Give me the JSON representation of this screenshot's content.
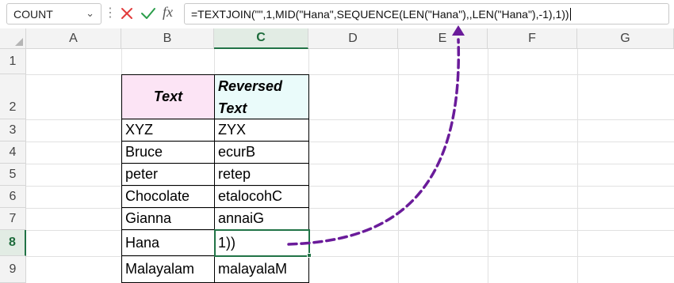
{
  "formula_bar": {
    "name_box": "COUNT",
    "formula": "=TEXTJOIN(\"\",1,MID(\"Hana\",SEQUENCE(LEN(\"Hana\"),,LEN(\"Hana\"),-1),1))",
    "icons": {
      "cancel": "x-icon",
      "enter": "check-icon",
      "function": "fx-icon",
      "more": "vertical-dots-icon"
    },
    "fx_label": "fx"
  },
  "columns": [
    "A",
    "B",
    "C",
    "D",
    "E",
    "F",
    "G"
  ],
  "rows": [
    "1",
    "2",
    "3",
    "4",
    "5",
    "6",
    "7",
    "8",
    "9"
  ],
  "active_cell": {
    "column": "C",
    "row": "8"
  },
  "table": {
    "header_text": "Text",
    "header_reversed_line1": "Reversed",
    "header_reversed_line2": "Text",
    "rows": [
      {
        "text": "XYZ",
        "reversed": "ZYX"
      },
      {
        "text": "Bruce",
        "reversed": "ecurB"
      },
      {
        "text": "peter",
        "reversed": "retep"
      },
      {
        "text": "Chocolate",
        "reversed": "etalocohC"
      },
      {
        "text": "Gianna",
        "reversed": "annaiG"
      },
      {
        "text": "Hana",
        "reversed": "1))"
      },
      {
        "text": "Malayalam",
        "reversed": "malayalaM"
      }
    ]
  },
  "colors": {
    "header_b_fill": "#fce4f5",
    "header_c_fill": "#eafbfa",
    "selection": "#217346",
    "annotation_arrow": "#6a1b9a"
  }
}
